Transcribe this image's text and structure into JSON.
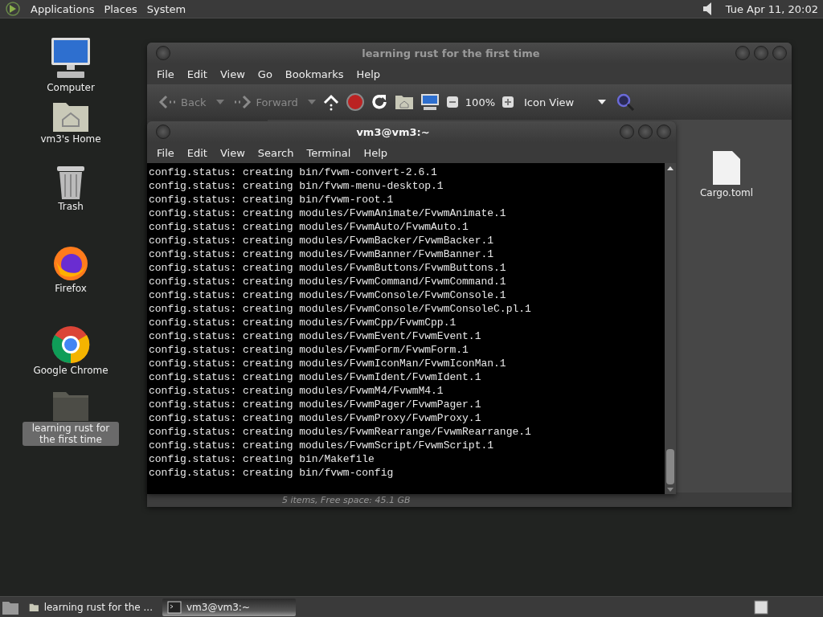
{
  "top_panel": {
    "menus": [
      "Applications",
      "Places",
      "System"
    ],
    "clock": "Tue Apr 11, 20:02"
  },
  "desktop_icons": [
    {
      "label": "Computer",
      "kind": "computer",
      "selected": false
    },
    {
      "label": "vm3's Home",
      "kind": "home",
      "selected": false
    },
    {
      "label": "Trash",
      "kind": "trash",
      "selected": false
    },
    {
      "label": "Firefox",
      "kind": "firefox",
      "selected": false
    },
    {
      "label": "Google Chrome",
      "kind": "chrome",
      "selected": false
    },
    {
      "label": "learning rust for the first time",
      "kind": "folder",
      "selected": true
    }
  ],
  "file_manager": {
    "title": "learning rust for the first time",
    "menu": [
      "File",
      "Edit",
      "View",
      "Go",
      "Bookmarks",
      "Help"
    ],
    "toolbar": {
      "back": {
        "label": "Back",
        "disabled": true
      },
      "forward": {
        "label": "Forward",
        "disabled": true
      },
      "zoom": "100%",
      "view": "Icon View"
    },
    "files": [
      {
        "name": "Cargo.toml"
      }
    ],
    "status": "5 items, Free space: 45.1 GB"
  },
  "terminal": {
    "title": "vm3@vm3:~",
    "menu": [
      "File",
      "Edit",
      "View",
      "Search",
      "Terminal",
      "Help"
    ],
    "lines": [
      "config.status: creating bin/fvwm-convert-2.6.1",
      "config.status: creating bin/fvwm-menu-desktop.1",
      "config.status: creating bin/fvwm-root.1",
      "config.status: creating modules/FvwmAnimate/FvwmAnimate.1",
      "config.status: creating modules/FvwmAuto/FvwmAuto.1",
      "config.status: creating modules/FvwmBacker/FvwmBacker.1",
      "config.status: creating modules/FvwmBanner/FvwmBanner.1",
      "config.status: creating modules/FvwmButtons/FvwmButtons.1",
      "config.status: creating modules/FvwmCommand/FvwmCommand.1",
      "config.status: creating modules/FvwmConsole/FvwmConsole.1",
      "config.status: creating modules/FvwmConsole/FvwmConsoleC.pl.1",
      "config.status: creating modules/FvwmCpp/FvwmCpp.1",
      "config.status: creating modules/FvwmEvent/FvwmEvent.1",
      "config.status: creating modules/FvwmForm/FvwmForm.1",
      "config.status: creating modules/FvwmIconMan/FvwmIconMan.1",
      "config.status: creating modules/FvwmIdent/FvwmIdent.1",
      "config.status: creating modules/FvwmM4/FvwmM4.1",
      "config.status: creating modules/FvwmPager/FvwmPager.1",
      "config.status: creating modules/FvwmProxy/FvwmProxy.1",
      "config.status: creating modules/FvwmRearrange/FvwmRearrange.1",
      "config.status: creating modules/FvwmScript/FvwmScript.1",
      "config.status: creating bin/Makefile",
      "config.status: creating bin/fvwm-config"
    ]
  },
  "taskbar": {
    "items": [
      {
        "label": "learning rust for the ...",
        "kind": "folder",
        "selected": false
      },
      {
        "label": "vm3@vm3:~",
        "kind": "terminal",
        "selected": true
      }
    ]
  }
}
